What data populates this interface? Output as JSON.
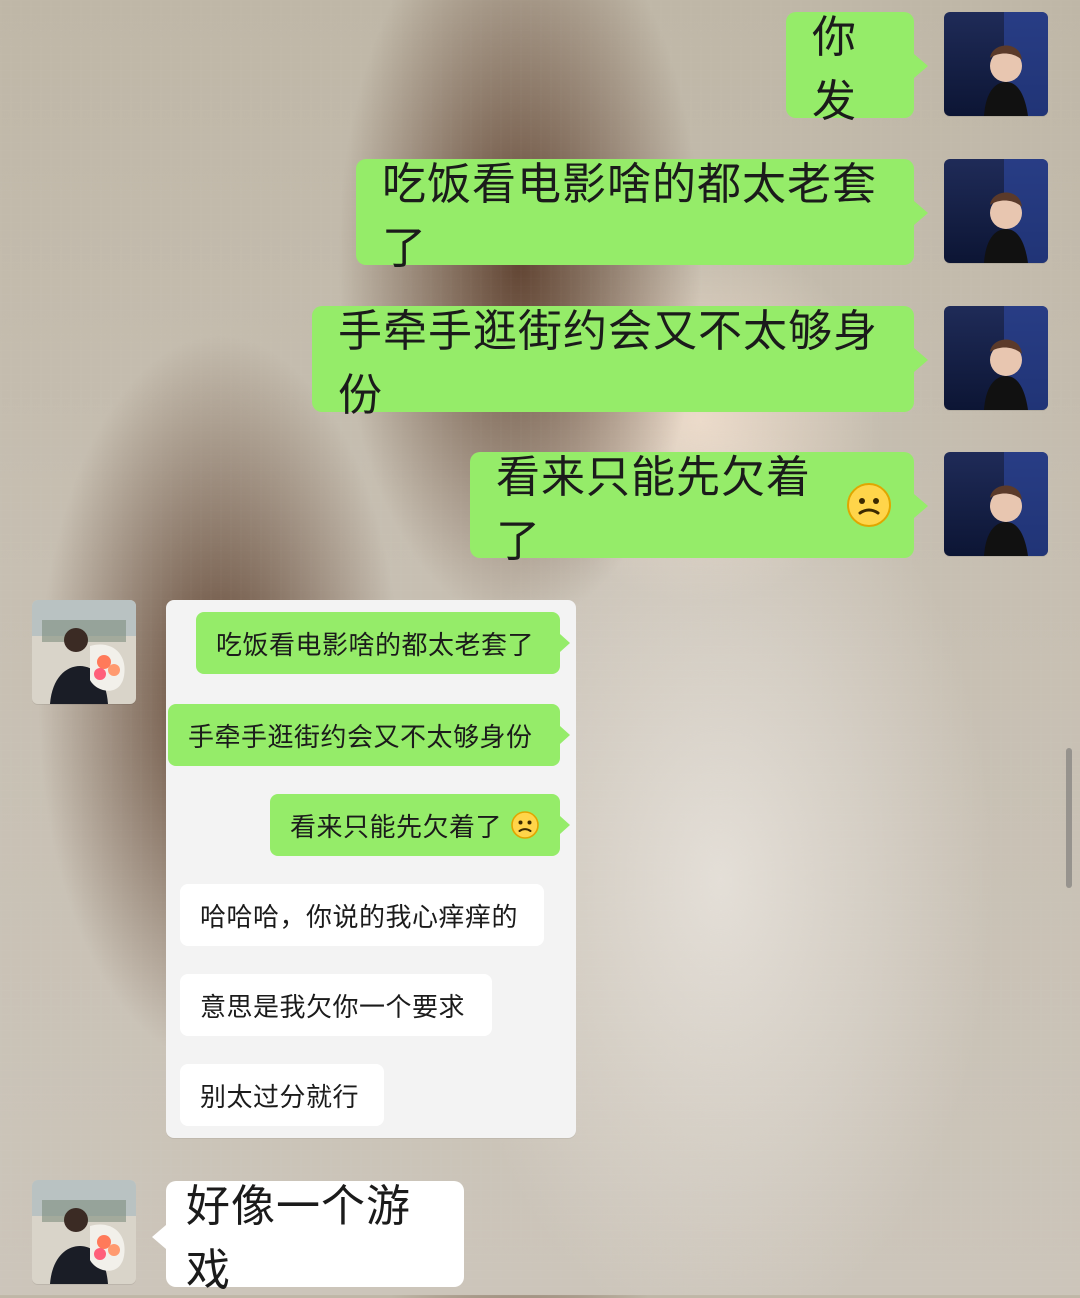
{
  "chat": {
    "outgoing": [
      {
        "text": "你发"
      },
      {
        "text": "吃饭看电影啥的都太老套了"
      },
      {
        "text": "手牵手逛街约会又不太够身份"
      },
      {
        "text": "看来只能先欠着了",
        "emoji": "confused-face"
      }
    ],
    "embedded_screenshot": {
      "outgoing": [
        {
          "text": "吃饭看电影啥的都太老套了"
        },
        {
          "text": "手牵手逛街约会又不太够身份"
        },
        {
          "text": "看来只能先欠着了",
          "emoji": "worried-face"
        }
      ],
      "incoming": [
        {
          "text": "哈哈哈，你说的我心痒痒的"
        },
        {
          "text": "意思是我欠你一个要求"
        },
        {
          "text": "别太过分就行"
        }
      ]
    },
    "incoming_last": {
      "text": "好像一个游戏"
    }
  },
  "colors": {
    "outgoing_bubble": "#95ec69",
    "incoming_bubble": "#ffffff",
    "panel_bg": "#f3f3f3"
  }
}
